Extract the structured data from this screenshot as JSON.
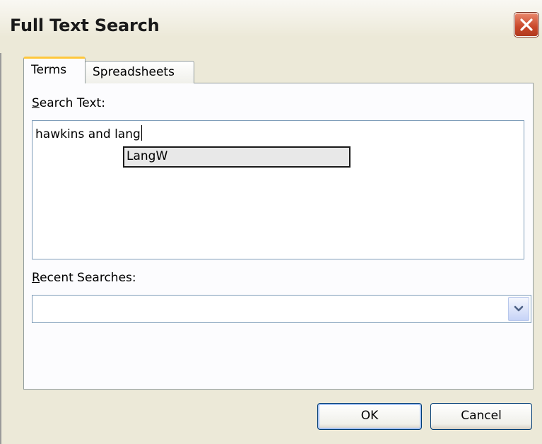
{
  "window": {
    "title": "Full Text Search"
  },
  "tabs": [
    {
      "label": "Terms",
      "selected": true
    },
    {
      "label": "Spreadsheets",
      "selected": false
    }
  ],
  "search_text": {
    "label_accel": "S",
    "label_rest": "earch Text:",
    "value": "hawkins and lang",
    "suggestion": "LangW"
  },
  "recent_searches": {
    "label_accel": "R",
    "label_rest": "ecent Searches:",
    "value": ""
  },
  "buttons": {
    "ok": "OK",
    "cancel": "Cancel"
  },
  "icons": {
    "close": "close-icon",
    "dropdown": "chevron-down-icon"
  },
  "colors": {
    "tab_highlight": "#ffc73c",
    "close_button": "#c9472a",
    "dialog_bg": "#ece9d8"
  }
}
